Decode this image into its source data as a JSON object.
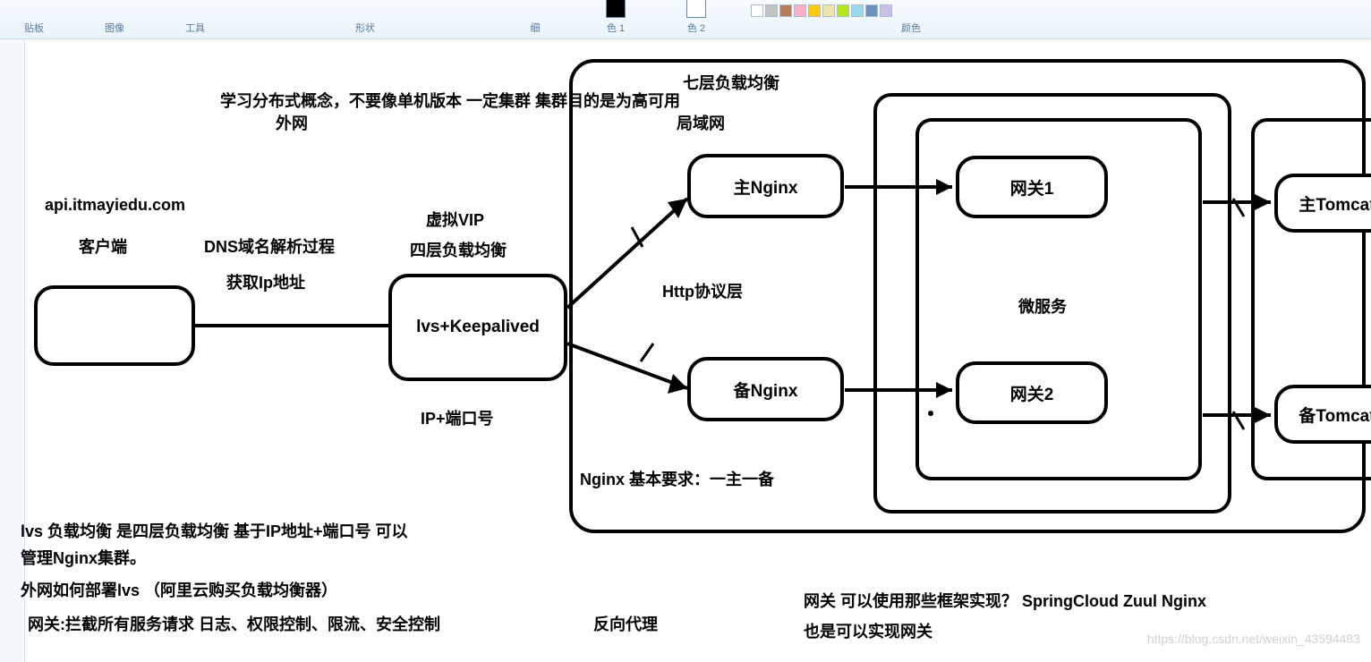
{
  "ribbon": {
    "groups": [
      "贴板",
      "图像",
      "工具",
      "形状",
      "颜色"
    ],
    "size_label": "细",
    "color1_label": "色 1",
    "color2_label": "色 2"
  },
  "diagram": {
    "title_top": "学习分布式概念，不要像单机版本 一定集群 集群目的是为高可用",
    "external_net": "外网",
    "lan": "局域网",
    "layer7": "七层负载均衡",
    "api_domain": "api.itmayiedu.com",
    "client": "客户端",
    "dns_process": "DNS域名解析过程",
    "get_ip": "获取Ip地址",
    "vip": "虚拟VIP",
    "layer4": "四层负载均衡",
    "lvs_box": "lvs+Keepalived",
    "ip_port": "IP+端口号",
    "http_layer": "Http协议层",
    "nginx_master": "主Nginx",
    "nginx_backup": "备Nginx",
    "nginx_req": "Nginx 基本要求：一主一备",
    "gateway1": "网关1",
    "gateway2": "网关2",
    "microservice": "微服务",
    "tomcat_master": "主Tomcat",
    "tomcat_backup": "备Tomcat",
    "note_lvs_1": "lvs 负载均衡 是四层负载均衡 基于IP地址+端口号 可以",
    "note_lvs_2": "管理Nginx集群。",
    "note_deploy": "外网如何部署lvs  （阿里云购买负载均衡器）",
    "note_gateway": "网关:拦截所有服务请求 日志、权限控制、限流、安全控制",
    "reverse_proxy": "反向代理",
    "gw_framework_1": "网关 可以使用那些框架实现？    SpringCloud Zuul Nginx",
    "gw_framework_2": "也是可以实现网关"
  },
  "watermark": "https://blog.csdn.net/weixin_43594483"
}
